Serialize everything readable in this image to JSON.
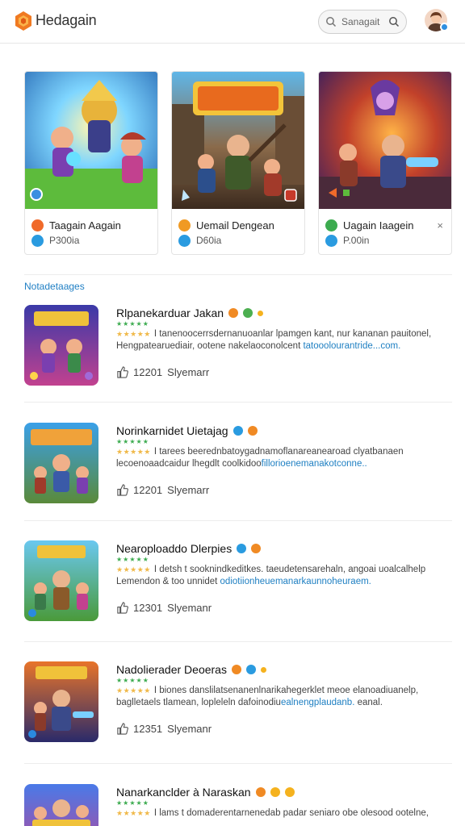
{
  "header": {
    "brand": "Hedagain",
    "search_text": "Sanagait",
    "icons": [
      "app-logo-icon",
      "search-icon",
      "avatar"
    ]
  },
  "featured": [
    {
      "title": "Taagain Aagain",
      "sub": "P300ia",
      "icon1_color": "#f06a2a",
      "icon2_color": "#2a9be0"
    },
    {
      "title": "Uemail Dengean",
      "sub": "D60ia",
      "icon1_color": "#f09a24",
      "icon2_color": "#2a9be0"
    },
    {
      "title": "Uagain Iaagein",
      "sub": "P.00in",
      "icon1_color": "#3cab4f",
      "icon2_color": "#2a9be0",
      "dismiss": "×"
    }
  ],
  "section": {
    "title": "Notadetaages"
  },
  "items": [
    {
      "name": "Rlpanekarduar Jakan",
      "desc1": "I tanenoocerrsdernanuoanlar lpamgen kant, nur kananan pauitonel,",
      "desc2_plain": "Hengpatearuediair, ootene nakelaoconolcent ",
      "desc2_link": "tatooolourantride...com.",
      "likes": "12201",
      "likes_label": "Slyemarr"
    },
    {
      "name": "Norinkarnidet Uietajag",
      "desc1": "I tarees beerednbatoygadnamoflanareanearoad clyatbanaen",
      "desc2_plain": "lecoenoaadcaidur lhegdlt coolkidoo",
      "desc2_link": "fillorioenemanakotconne..",
      "likes": "12201",
      "likes_label": "Slyemarr"
    },
    {
      "name": "Nearoploaddo Dlerpies",
      "desc1": "I detsh t sooknindkeditkes. taeudetensarehaln, angoai uoalcalhelp",
      "desc2_plain": "Lemendon & too unnidet ",
      "desc2_link": "odiotiionheuemanarkaunnoheuraem.",
      "likes": "12301",
      "likes_label": "Slyemanr"
    },
    {
      "name": "Nadolierader Deoeras",
      "desc1": "I biones danslilatsenanenlnarikahegerklet meoe elanoadiuanelp,",
      "desc2_plain": "baglletaels tlamean, lopleleln dafoinodiu",
      "desc2_link": "ealnengplaudanb.",
      "desc2_tail": " eanal.",
      "likes": "12351",
      "likes_label": "Slyemanr"
    },
    {
      "name": "Nanarkanclder à Naraskan",
      "desc1": "I lams t domaderentarnenedab padar seniaro obe olesood ootelne,",
      "desc2_plain": "",
      "desc2_link": "",
      "likes": "",
      "likes_label": ""
    }
  ]
}
